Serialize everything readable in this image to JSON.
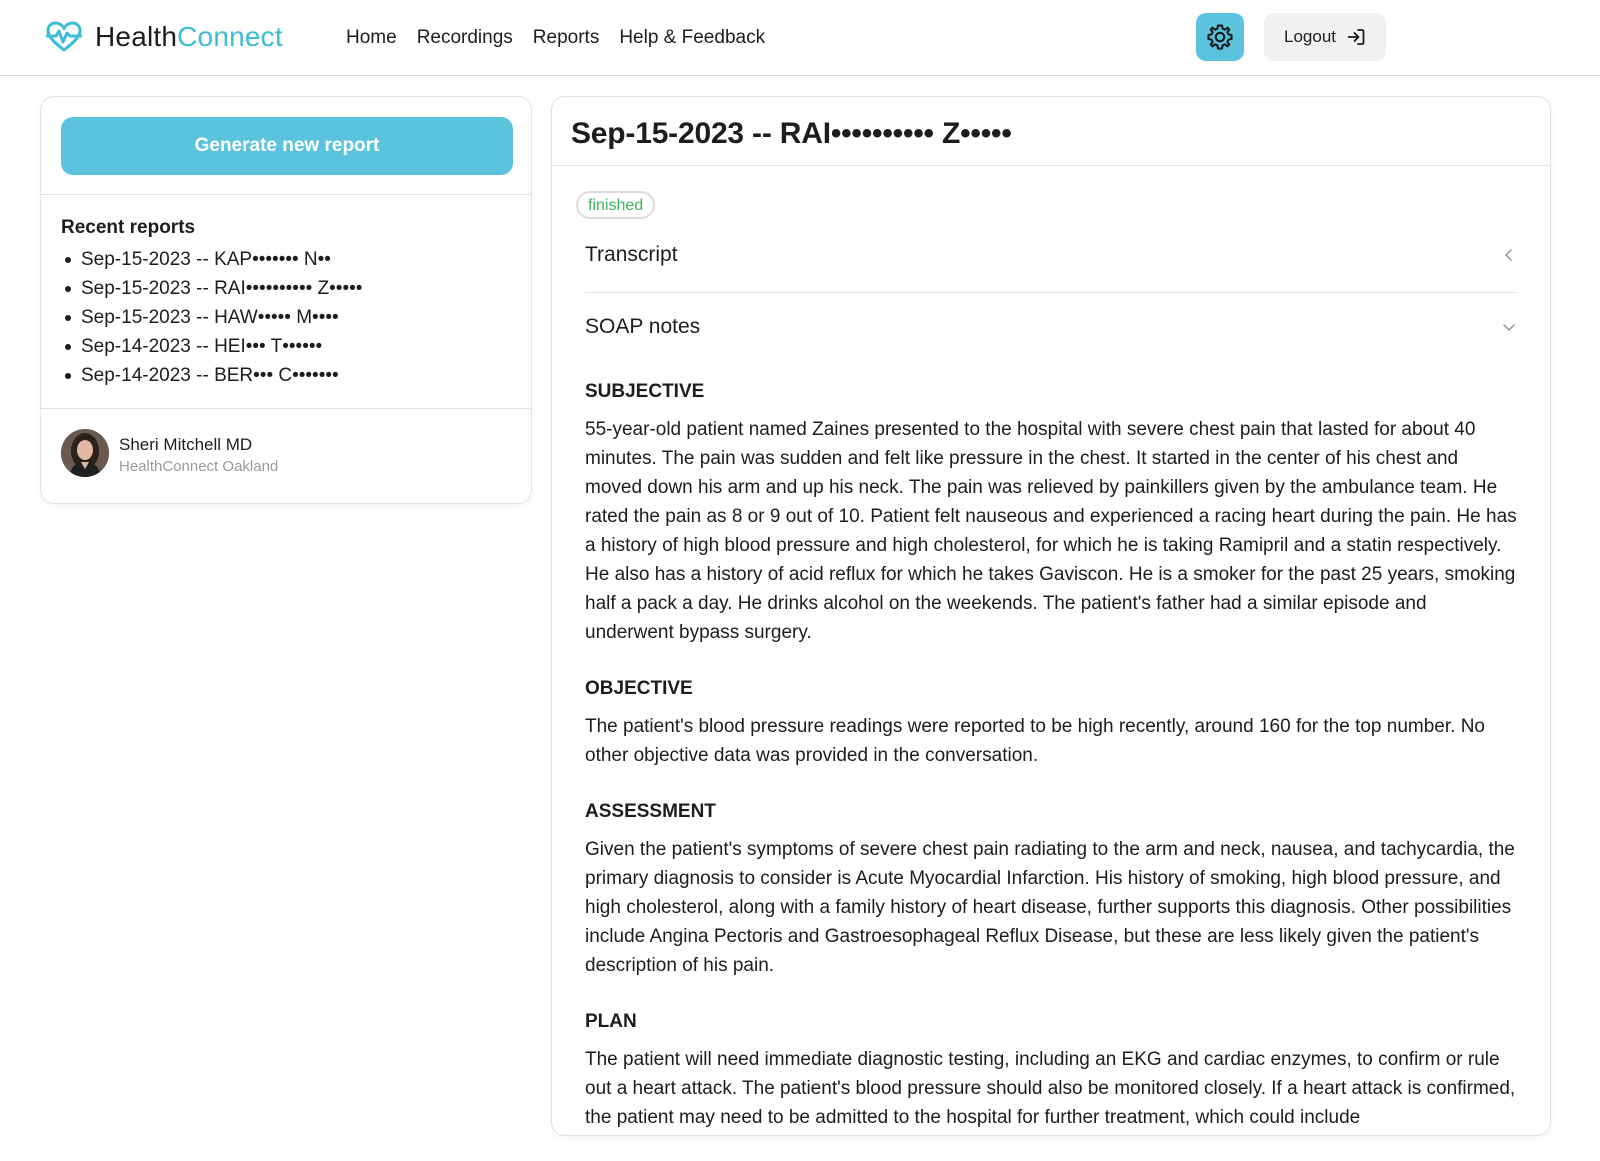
{
  "header": {
    "brand_part1": "Health",
    "brand_part2": "Connect",
    "brand_color": "#3cbcd6",
    "brand_icon": "heartbeat-icon",
    "nav": [
      {
        "label": "Home"
      },
      {
        "label": "Recordings"
      },
      {
        "label": "Reports"
      },
      {
        "label": "Help & Feedback"
      }
    ],
    "settings_icon": "gear-icon",
    "logout_label": "Logout",
    "logout_icon": "sign-in-icon"
  },
  "sidebar": {
    "generate_label": "Generate new report",
    "recent_title": "Recent reports",
    "recent_reports": [
      {
        "label": "Sep-15-2023 -- KAP••••••• N••"
      },
      {
        "label": "Sep-15-2023 -- RAI•••••••••• Z•••••"
      },
      {
        "label": "Sep-15-2023 -- HAW••••• M••••"
      },
      {
        "label": "Sep-14-2023 -- HEI••• T••••••"
      },
      {
        "label": "Sep-14-2023 -- BER••• C•••••••"
      }
    ],
    "user": {
      "name": "Sheri Mitchell MD",
      "organization": "HealthConnect Oakland"
    }
  },
  "report": {
    "title": "Sep-15-2023 -- RAI•••••••••• Z•••••",
    "status": "finished",
    "status_color": "#3bb55c",
    "transcript_label": "Transcript",
    "soap_label": "SOAP notes",
    "sections": [
      {
        "heading": "SUBJECTIVE",
        "text": "55-year-old patient named Zaines presented to the hospital with severe chest pain that lasted for about 40 minutes. The pain was sudden and felt like pressure in the chest. It started in the center of his chest and moved down his arm and up his neck. The pain was relieved by painkillers given by the ambulance team. He rated the pain as 8 or 9 out of 10. Patient felt nauseous and experienced a racing heart during the pain. He has a history of high blood pressure and high cholesterol, for which he is taking Ramipril and a statin respectively. He also has a history of acid reflux for which he takes Gaviscon. He is a smoker for the past 25 years, smoking half a pack a day. He drinks alcohol on the weekends. The patient's father had a similar episode and underwent bypass surgery."
      },
      {
        "heading": "OBJECTIVE",
        "text": "The patient's blood pressure readings were reported to be high recently, around 160 for the top number. No other objective data was provided in the conversation."
      },
      {
        "heading": "ASSESSMENT",
        "text": "Given the patient's symptoms of severe chest pain radiating to the arm and neck, nausea, and tachycardia, the primary diagnosis to consider is Acute Myocardial Infarction. His history of smoking, high blood pressure, and high cholesterol, along with a family history of heart disease, further supports this diagnosis. Other possibilities include Angina Pectoris and Gastroesophageal Reflux Disease, but these are less likely given the patient's description of his pain."
      },
      {
        "heading": "PLAN",
        "text": "The patient will need immediate diagnostic testing, including an EKG and cardiac enzymes, to confirm or rule out a heart attack. The patient's blood pressure should also be monitored closely. If a heart attack is confirmed, the patient may need to be admitted to the hospital for further treatment, which could include"
      }
    ]
  }
}
